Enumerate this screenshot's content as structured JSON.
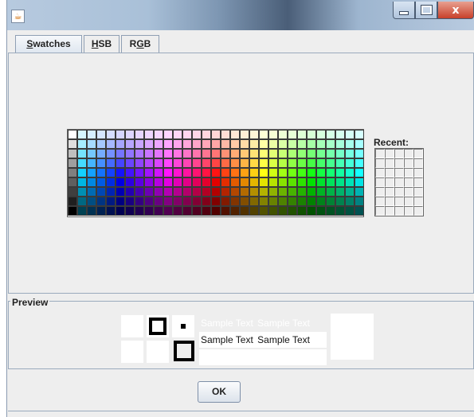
{
  "window": {
    "icon": "java-cup-icon",
    "controls": {
      "minimize": "minimize-icon",
      "maximize": "maximize-icon",
      "close": "x"
    }
  },
  "tabs": [
    {
      "label": "Swatches",
      "mnemonic": "S",
      "selected": true
    },
    {
      "label": "HSB",
      "mnemonic": "H",
      "selected": false
    },
    {
      "label": "RGB",
      "mnemonic": "G",
      "selected": false
    }
  ],
  "swatches": {
    "columns": 31,
    "rows": 9
  },
  "recent": {
    "label": "Recent:",
    "columns": 5,
    "rows": 7
  },
  "preview": {
    "title": "Preview",
    "sample_text": "Sample Text"
  },
  "buttons": {
    "ok": "OK"
  },
  "colors": {
    "window_bg": "#eeeeee",
    "border": "#9aaabd",
    "preview_fg": "#ffffff",
    "preview_text": "#000000"
  }
}
